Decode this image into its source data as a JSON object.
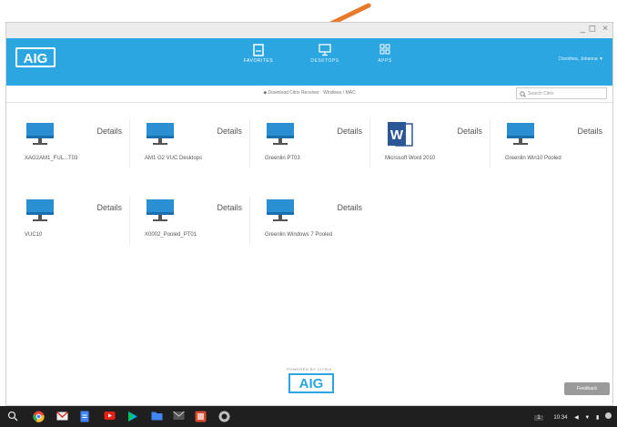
{
  "app": {
    "logo": "AIG"
  },
  "window_controls": {
    "minimize": "_",
    "maximize": "◻",
    "close": "×"
  },
  "nav": {
    "tabs": [
      {
        "label": "FAVORITES",
        "active": true
      },
      {
        "label": "DESKTOPS",
        "active": false
      },
      {
        "label": "APPS",
        "active": false
      }
    ],
    "user": "Dorothea, Johanna ▼"
  },
  "breadcrumb": "◆ Download Citrix Receiver · Windows / MAC",
  "search": {
    "placeholder": "Search Citrix"
  },
  "tiles": [
    {
      "name": "XAG2AM1_FUL...T03",
      "details": "Details",
      "icon": "monitor-icon"
    },
    {
      "name": "AM1 G2 VUC Desktops",
      "details": "Details",
      "icon": "monitor-icon"
    },
    {
      "name": "Greenlin PT03",
      "details": "Details",
      "icon": "monitor-icon"
    },
    {
      "name": "Microsoft Word 2010",
      "details": "Details",
      "icon": "word-icon"
    },
    {
      "name": "Greenlin Win10 Pooled",
      "details": "Details",
      "icon": "monitor-icon"
    },
    {
      "name": "VUC10",
      "details": "Details",
      "icon": "monitor-icon"
    },
    {
      "name": "X0002_Pooled_PT01",
      "details": "Details",
      "icon": "monitor-icon"
    },
    {
      "name": "Greenlin Windows 7 Pooled",
      "details": "Details",
      "icon": "monitor-icon"
    }
  ],
  "footer": {
    "caption": "POWERED BY CITRIX",
    "logo": "AIG",
    "feedback": "Feedback"
  },
  "taskbar": {
    "time": "10:34",
    "notification": "1"
  },
  "colors": {
    "brand": "#2ba6e1",
    "arrow": "#e8782a",
    "taskbar": "#1f1f1f"
  }
}
